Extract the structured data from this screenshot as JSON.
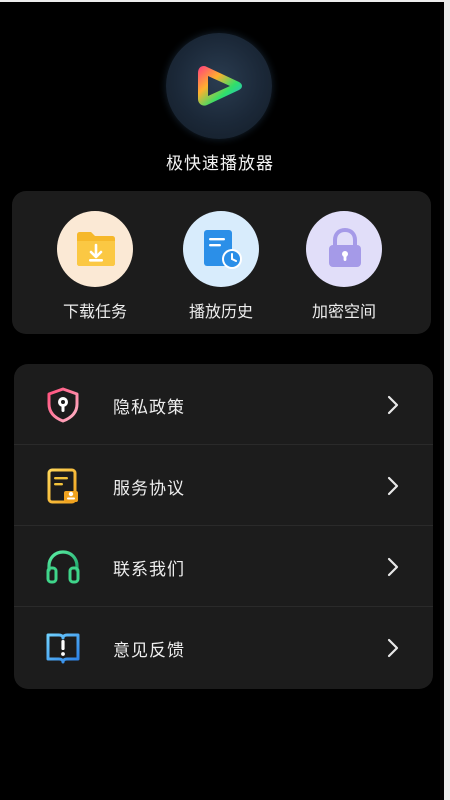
{
  "app": {
    "name": "极快速播放器",
    "logo_icon": "play-triangle-logo-icon"
  },
  "quick_actions": [
    {
      "label": "下载任务",
      "icon": "download-folder-icon",
      "bg": "#fbe9d5",
      "accent": "#f6b82a"
    },
    {
      "label": "播放历史",
      "icon": "history-document-clock-icon",
      "bg": "#d8ecfc",
      "accent": "#2b8fe8"
    },
    {
      "label": "加密空间",
      "icon": "lock-icon",
      "bg": "#e1def9",
      "accent": "#9a8ee6"
    }
  ],
  "menu": [
    {
      "label": "隐私政策",
      "icon": "shield-keyhole-icon"
    },
    {
      "label": "服务协议",
      "icon": "agreement-document-icon"
    },
    {
      "label": "联系我们",
      "icon": "headset-icon"
    },
    {
      "label": "意见反馈",
      "icon": "feedback-book-icon"
    }
  ],
  "colors": {
    "background": "#000000",
    "card": "#1c1c1c",
    "text": "#eeeeee"
  }
}
